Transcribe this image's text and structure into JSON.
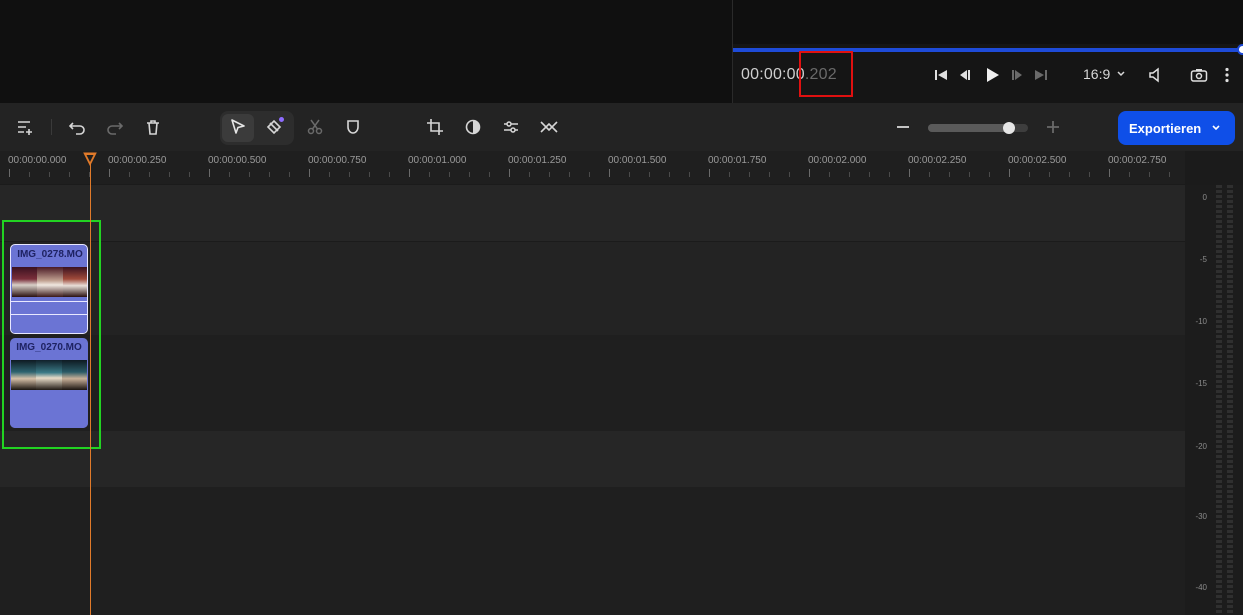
{
  "player": {
    "timecode_main": "00:00:00",
    "timecode_frac": ".202",
    "aspect_ratio": "16:9",
    "progress_fraction": 1.0
  },
  "toolbar": {
    "export_label": "Exportieren",
    "zoom_level_fraction": 0.85
  },
  "ruler": {
    "labels": [
      "00:00:00.000",
      "00:00:00.250",
      "00:00:00.500",
      "00:00:00.750",
      "00:00:01.000",
      "00:00:01.250",
      "00:00:01.500",
      "00:00:01.750",
      "00:00:02.000",
      "00:00:02.250",
      "00:00:02.500",
      "00:00:02.750"
    ]
  },
  "clips": [
    {
      "title": "IMG_0278.MO"
    },
    {
      "title": "IMG_0270.MO"
    }
  ],
  "meter": {
    "labels": [
      "0",
      "-5",
      "-10",
      "-15",
      "-20",
      "-30",
      "-40"
    ]
  },
  "colors": {
    "accent": "#0f4fe8",
    "playhead": "#e07a2a",
    "clip": "#6b74d4",
    "selection": "#22d322",
    "highlight": "#e01010"
  }
}
